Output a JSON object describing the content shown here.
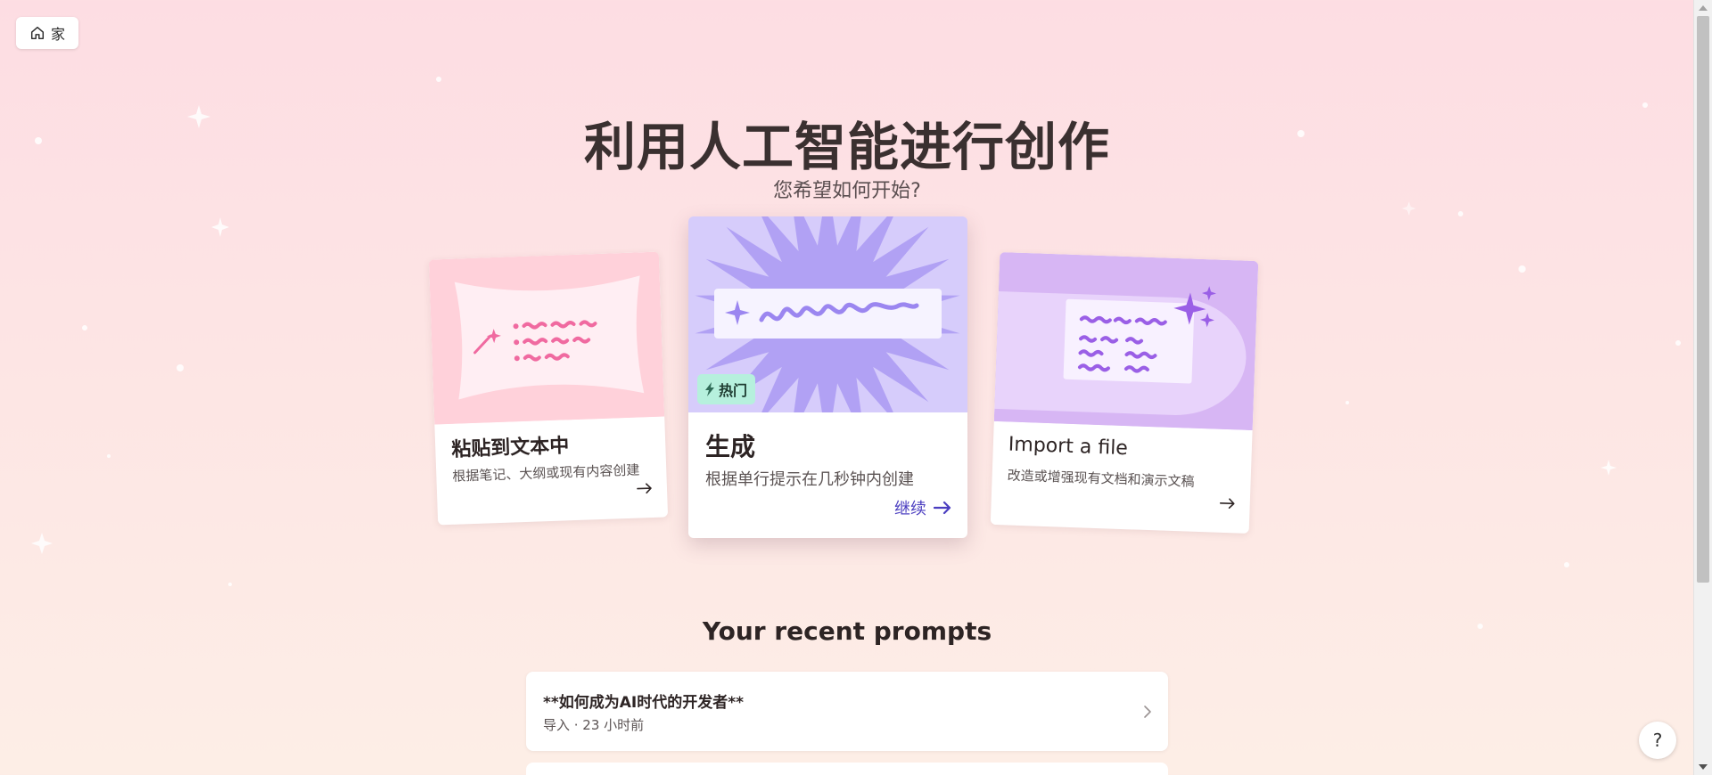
{
  "nav": {
    "home_label": "家",
    "home_icon": "home-icon"
  },
  "hero": {
    "title": "利用人工智能进行创作",
    "subtitle": "您希望如何开始?"
  },
  "cards": {
    "paste": {
      "title": "粘贴到文本中",
      "description": "根据笔记、大纲或现有内容创建",
      "icon": "arrow-right-icon"
    },
    "generate": {
      "badge": "热门",
      "title": "生成",
      "description": "根据单行提示在几秒钟内创建",
      "continue_label": "继续",
      "icon": "arrow-right-icon"
    },
    "import": {
      "title": "Import a file",
      "description": "改造或增强现有文档和演示文稿",
      "icon": "arrow-right-icon"
    }
  },
  "recent": {
    "heading": "Your recent prompts",
    "items": [
      {
        "title": "**如何成为AI时代的开发者**",
        "meta": "导入 · 23 小时前"
      }
    ]
  },
  "help": {
    "label": "?"
  },
  "colors": {
    "accent": "#4b3ec0",
    "badge_bg": "#b6f0dd",
    "paste_art": "#ffd1da",
    "generate_art": "#d6ccfb",
    "import_art": "#d7b6f4"
  }
}
